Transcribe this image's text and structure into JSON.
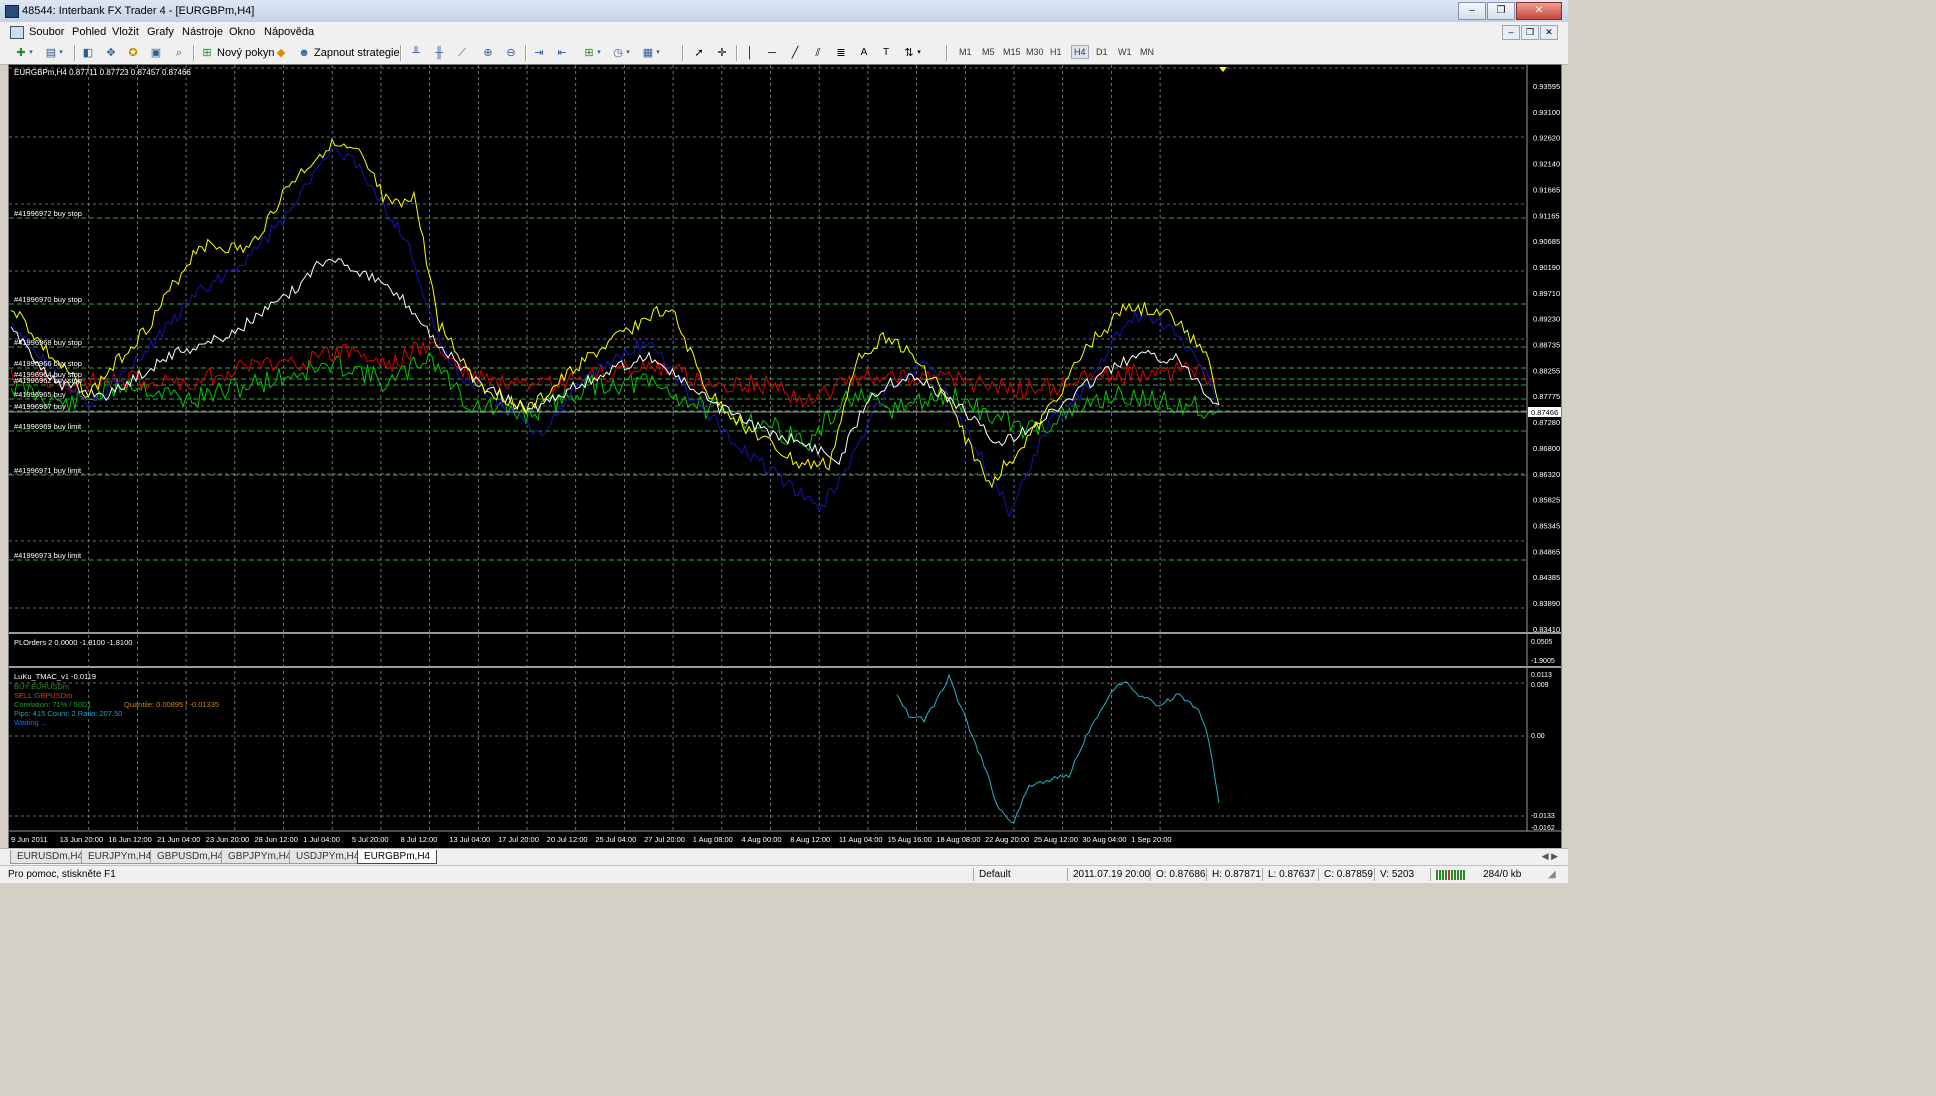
{
  "window": {
    "title": "48544: Interbank FX Trader 4 - [EURGBPm,H4]"
  },
  "menu": [
    "Soubor",
    "Pohled",
    "Vložit",
    "Grafy",
    "Nástroje",
    "Okno",
    "Nápověda"
  ],
  "toolbar": {
    "new_order": "Nový pokyn",
    "strategy": "Zapnout strategie"
  },
  "timeframes": [
    "M1",
    "M5",
    "M15",
    "M30",
    "H1",
    "H4",
    "D1",
    "W1",
    "MN"
  ],
  "active_timeframe": "H4",
  "chart": {
    "header": "EURGBPm,H4  0.87711 0.87723 0.87457 0.87466",
    "current_price": "0.87466",
    "price_labels": [
      "0.93595",
      "0.93100",
      "0.92620",
      "0.92140",
      "0.91665",
      "0.91165",
      "0.90685",
      "0.90190",
      "0.89710",
      "0.89230",
      "0.88735",
      "0.88255",
      "0.87775",
      "0.87280",
      "0.86800",
      "0.86320",
      "0.85825",
      "0.85345",
      "0.84865",
      "0.84385",
      "0.83890",
      "0.83410"
    ],
    "orders": [
      {
        "label": "#41996972 buy stop"
      },
      {
        "label": "#41996970 buy stop"
      },
      {
        "label": "#41996968 buy stop"
      },
      {
        "label": "#41996966 buy stop"
      },
      {
        "label": "#41996964 buy stop"
      },
      {
        "label": "#41996962 buy stop"
      },
      {
        "label": "#41996965 buy"
      },
      {
        "label": "#41996967 buy"
      },
      {
        "label": "#41996969 buy limit"
      },
      {
        "label": "#41996971 buy limit"
      },
      {
        "label": "#41996973 buy limit"
      }
    ],
    "series_colors": {
      "yellow": "#ffff00",
      "blue": "#1414b4",
      "white": "#ffffff",
      "red": "#e00000",
      "green": "#00c800"
    }
  },
  "plorders": {
    "header": "PLOrders 2 0.0000 -1.8100 -1.8100",
    "labels": [
      "0.0505",
      "-1.9005"
    ]
  },
  "tmac": {
    "header": "LuKu_TMAC_v1 -0.0119",
    "line_buy": "BUY:EURUSDm",
    "line_sell": "SELL:GBPUSDm",
    "line_corr": "Corelation: 71% / 50D1",
    "line_quant": "Quantile: 0.00895 / -0.01335",
    "line_pips": "Pips: 415 Count: 2 Ratio: 207.50",
    "line_wait": "Waiting ...",
    "labels": [
      "0.0113",
      "0.009",
      "0.00",
      "-0.0133",
      "-0.0162"
    ],
    "line_color": "#20b4c8"
  },
  "time_axis": [
    "9 Jun 2011",
    "13 Jun 20:00",
    "16 Jun 12:00",
    "21 Jun 04:00",
    "23 Jun 20:00",
    "28 Jun 12:00",
    "1 Jul 04:00",
    "5 Jul 20:00",
    "8 Jul 12:00",
    "13 Jul 04:00",
    "17 Jul 20:00",
    "20 Jul 12:00",
    "25 Jul 04:00",
    "27 Jul 20:00",
    "1 Aug 08:00",
    "4 Aug 00:00",
    "8 Aug 12:00",
    "11 Aug 04:00",
    "15 Aug 16:00",
    "18 Aug 08:00",
    "22 Aug 20:00",
    "25 Aug 12:00",
    "30 Aug 04:00",
    "1 Sep 20:00"
  ],
  "tabs": [
    "EURUSDm,H4",
    "EURJPYm,H4",
    "GBPUSDm,H4",
    "GBPJPYm,H4",
    "USDJPYm,H4",
    "EURGBPm,H4"
  ],
  "active_tab": "EURGBPm,H4",
  "status": {
    "help": "Pro pomoc, stiskněte F1",
    "profile": "Default",
    "datetime": "2011.07.19 20:00",
    "open": "O: 0.87686",
    "high": "H: 0.87871",
    "low": "L: 0.87637",
    "close": "C: 0.87859",
    "volume": "V: 5203",
    "traffic": "284/0 kb"
  }
}
